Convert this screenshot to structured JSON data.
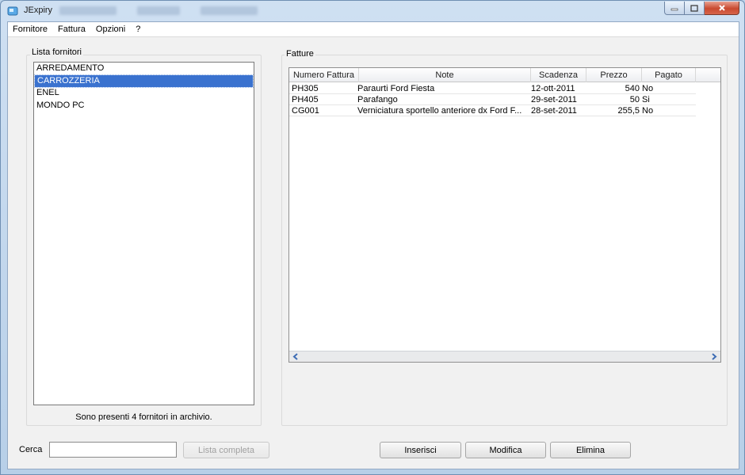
{
  "window": {
    "title": "JExpiry"
  },
  "menu": [
    {
      "label": "Fornitore"
    },
    {
      "label": "Fattura"
    },
    {
      "label": "Opzioni"
    },
    {
      "label": "?"
    }
  ],
  "suppliers": {
    "title": "Lista fornitori",
    "items": [
      {
        "label": "ARREDAMENTO",
        "selected": false
      },
      {
        "label": "CARROZZERIA",
        "selected": true
      },
      {
        "label": "ENEL",
        "selected": false
      },
      {
        "label": "MONDO PC",
        "selected": false
      }
    ],
    "status": "Sono presenti 4 fornitori in archivio."
  },
  "invoices": {
    "title": "Fatture",
    "columns": [
      "Numero Fattura",
      "Note",
      "Scadenza",
      "Prezzo",
      "Pagato"
    ],
    "rows": [
      {
        "numero": "PH305",
        "note": "Paraurti Ford Fiesta",
        "scadenza": "12-ott-2011",
        "prezzo": "540",
        "pagato": "No"
      },
      {
        "numero": "PH405",
        "note": "Parafango",
        "scadenza": "29-set-2011",
        "prezzo": "50",
        "pagato": "Si"
      },
      {
        "numero": "CG001",
        "note": "Verniciatura sportello anteriore dx Ford F...",
        "scadenza": "28-set-2011",
        "prezzo": "255,5",
        "pagato": "No"
      }
    ]
  },
  "search": {
    "label": "Cerca",
    "value": "",
    "list_all_label": "Lista completa"
  },
  "actions": {
    "insert": "Inserisci",
    "edit": "Modifica",
    "delete": "Elimina"
  },
  "colors": {
    "selection": "#3a72cf",
    "scroll_arrow": "#4a73b7",
    "close_button": "#c9492f"
  },
  "icons": {
    "app": "app-icon",
    "minimize": "minimize-icon",
    "maximize": "maximize-icon",
    "close": "close-icon",
    "scroll_left": "arrow-left-icon",
    "scroll_right": "arrow-right-icon"
  }
}
